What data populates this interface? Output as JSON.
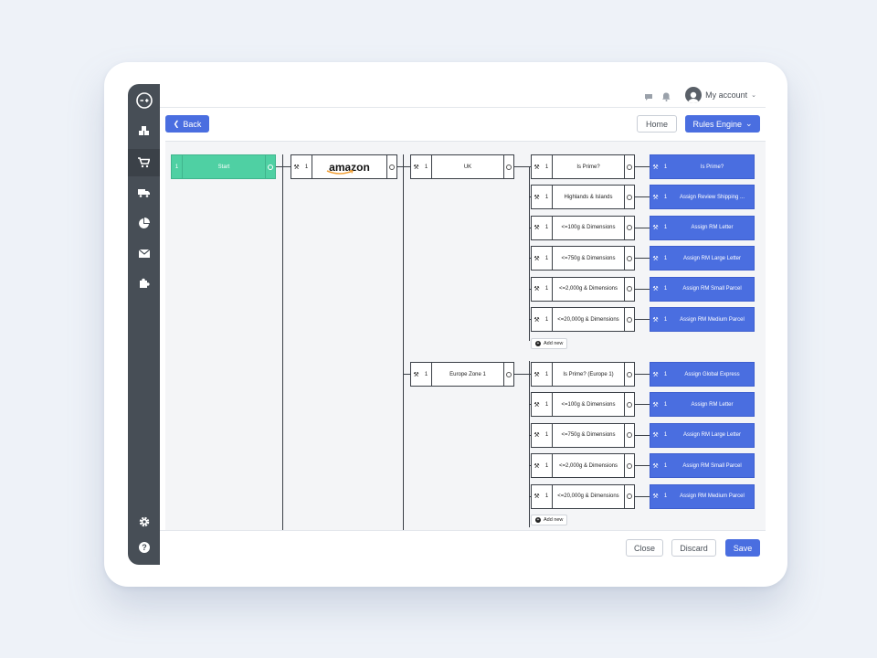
{
  "header": {
    "account_label": "My account"
  },
  "toolbar": {
    "back_label": "Back",
    "home_label": "Home",
    "rules_engine_label": "Rules Engine"
  },
  "footer": {
    "close_label": "Close",
    "discard_label": "Discard",
    "save_label": "Save"
  },
  "nav": {
    "icons": [
      "inventory-icon",
      "cart-icon",
      "truck-icon",
      "pie-chart-icon",
      "mail-icon",
      "puzzle-icon",
      "settings-icon",
      "help-icon"
    ]
  },
  "tree": {
    "start": {
      "num": "1",
      "label": "Start"
    },
    "channel": {
      "num": "1",
      "logo_text": "amazon"
    },
    "regions": [
      {
        "num": "1",
        "label": "UK"
      },
      {
        "num": "1",
        "label": "Europe Zone 1"
      }
    ],
    "uk_rules": [
      {
        "num": "1",
        "label": "Is Prime?"
      },
      {
        "num": "1",
        "label": "Highlands & Islands"
      },
      {
        "num": "1",
        "label": "<=100g & Dimensions"
      },
      {
        "num": "1",
        "label": "<=750g & Dimensions"
      },
      {
        "num": "1",
        "label": "<=2,000g & Dimensions"
      },
      {
        "num": "1",
        "label": "<=20,000g & Dimensions"
      }
    ],
    "uk_actions": [
      {
        "num": "1",
        "label": "Is Prime?"
      },
      {
        "num": "1",
        "label": "Assign Review Shipping ..."
      },
      {
        "num": "1",
        "label": "Assign RM Letter"
      },
      {
        "num": "1",
        "label": "Assign RM Large Letter"
      },
      {
        "num": "1",
        "label": "Assign RM Small Parcel"
      },
      {
        "num": "1",
        "label": "Assign RM Medium Parcel"
      }
    ],
    "eu_rules": [
      {
        "num": "1",
        "label": "Is Prime? (Europe 1)"
      },
      {
        "num": "1",
        "label": "<=100g & Dimensions"
      },
      {
        "num": "1",
        "label": "<=750g & Dimensions"
      },
      {
        "num": "1",
        "label": "<=2,000g & Dimensions"
      },
      {
        "num": "1",
        "label": "<=20,000g & Dimensions"
      }
    ],
    "eu_actions": [
      {
        "num": "1",
        "label": "Assign Global Express"
      },
      {
        "num": "1",
        "label": "Assign RM Letter"
      },
      {
        "num": "1",
        "label": "Assign RM Large Letter"
      },
      {
        "num": "1",
        "label": "Assign RM Small Parcel"
      },
      {
        "num": "1",
        "label": "Assign RM Medium Parcel"
      }
    ],
    "add_new_label": "Add new"
  },
  "colors": {
    "accent": "#4a6ee0",
    "start": "#4fd0a3",
    "sidebar": "#474e56"
  }
}
